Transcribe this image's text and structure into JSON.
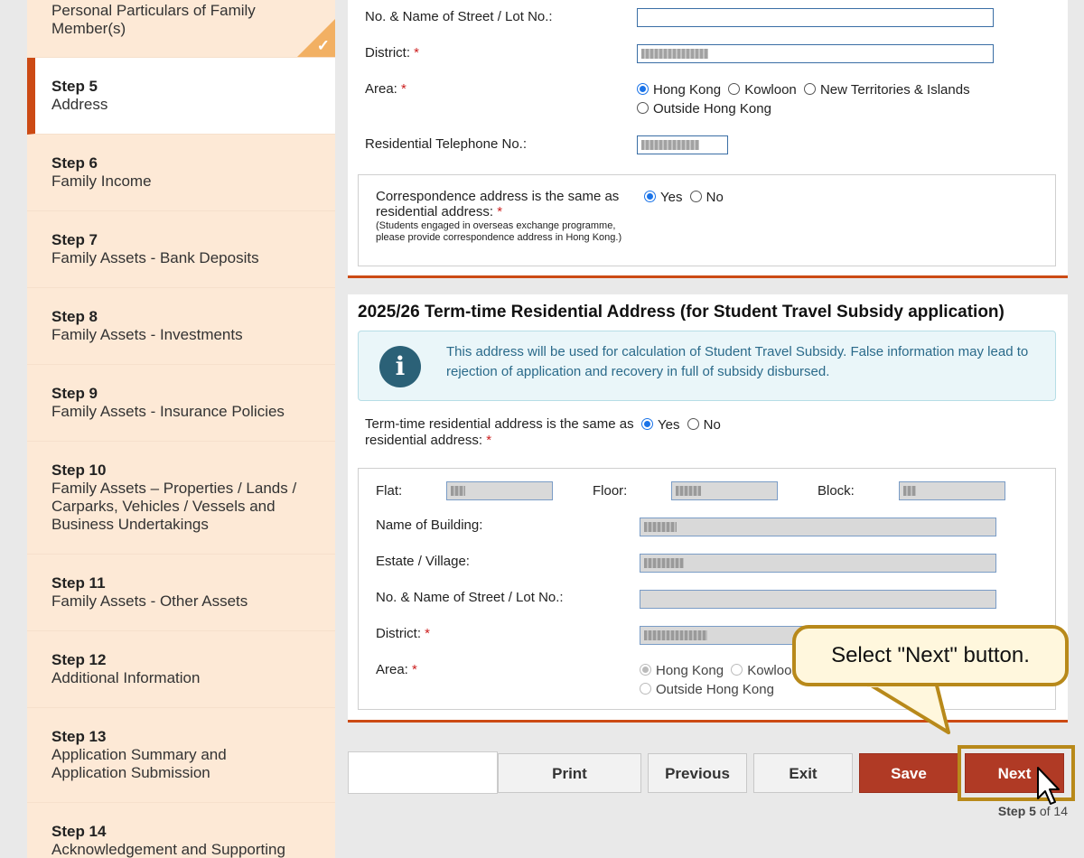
{
  "sidebar": {
    "items": [
      {
        "step": "",
        "label": "Personal Particulars of Family Member(s)",
        "completed": true
      },
      {
        "step": "Step 5",
        "label": "Address",
        "active": true
      },
      {
        "step": "Step 6",
        "label": "Family Income"
      },
      {
        "step": "Step 7",
        "label": "Family Assets - Bank Deposits"
      },
      {
        "step": "Step 8",
        "label": "Family Assets - Investments"
      },
      {
        "step": "Step 9",
        "label": "Family Assets - Insurance Policies"
      },
      {
        "step": "Step 10",
        "label": "Family Assets – Properties / Lands / Carparks, Vehicles / Vessels and Business Undertakings"
      },
      {
        "step": "Step 11",
        "label": "Family Assets - Other Assets"
      },
      {
        "step": "Step 12",
        "label": "Additional Information"
      },
      {
        "step": "Step 13",
        "label": "Application Summary and Application Submission"
      },
      {
        "step": "Step 14",
        "label": "Acknowledgement and Supporting"
      }
    ]
  },
  "residential": {
    "street_label": "No. & Name of Street / Lot No.:",
    "district_label": "District:",
    "area_label": "Area:",
    "tel_label": "Residential Telephone No.:",
    "area_options": [
      "Hong Kong",
      "Kowloon",
      "New Territories & Islands",
      "Outside Hong Kong"
    ],
    "area_selected": "Hong Kong",
    "required_mark": "*"
  },
  "correspondence": {
    "question": "Correspondence address is the same as residential address:",
    "note": "(Students engaged in overseas exchange programme, please provide correspondence address in Hong Kong.)",
    "yes": "Yes",
    "no": "No",
    "selected": "Yes"
  },
  "term_time": {
    "title": "2025/26 Term-time Residential Address (for Student Travel Subsidy application)",
    "info": "This address will be used for calculation of Student Travel Subsidy. False information may lead to rejection of application and recovery in full of subsidy disbursed.",
    "question": "Term-time residential address is the same as residential address:",
    "yes": "Yes",
    "no": "No",
    "selected": "Yes",
    "flat_label": "Flat:",
    "floor_label": "Floor:",
    "block_label": "Block:",
    "building_label": "Name of Building:",
    "estate_label": "Estate / Village:",
    "street_label": "No. & Name of Street / Lot No.:",
    "district_label": "District:",
    "area_label": "Area:",
    "area_options": [
      "Hong Kong",
      "Kowloon",
      "Outside Hong Kong"
    ],
    "area_selected": "Hong Kong"
  },
  "buttons": {
    "print": "Print",
    "previous": "Previous",
    "exit": "Exit",
    "save": "Save",
    "next": "Next"
  },
  "progress": {
    "prefix": "Step",
    "current": "5",
    "of_label": "of",
    "total": "14"
  },
  "callout": "Select \"Next\" button.",
  "colors": {
    "accent": "#cc4a14",
    "button_red": "#b03a25",
    "sidebar_bg": "#fde9d6",
    "highlight": "#b8891a"
  }
}
